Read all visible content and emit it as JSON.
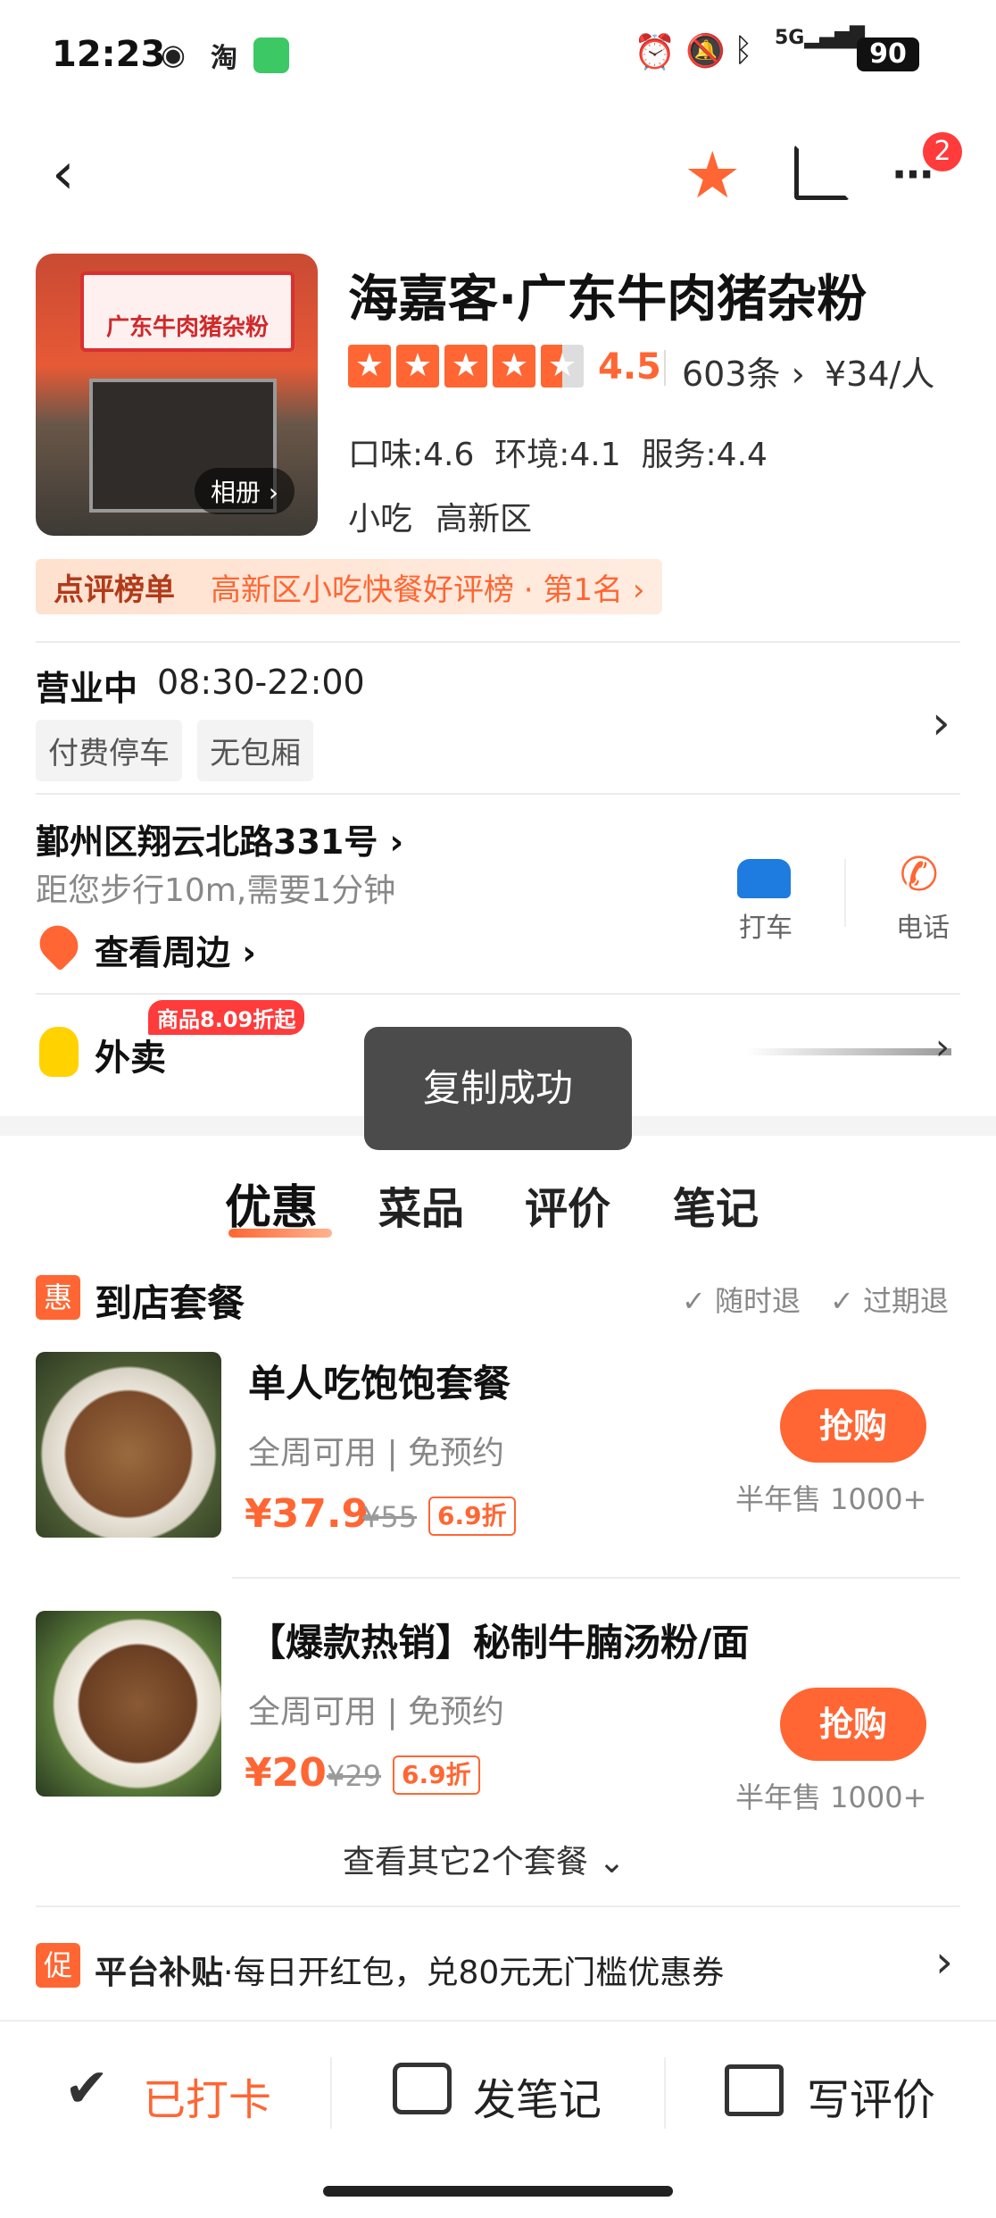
{
  "status": {
    "time": "12:23",
    "battery": "90"
  },
  "nav": {
    "badge_count": "2"
  },
  "shop": {
    "name": "海嘉客·广东牛肉猪杂粉",
    "sign": "广东牛肉猪杂粉",
    "album": "相册",
    "rating": "4.5",
    "stars": 4.5,
    "reviews": "603条",
    "price_per_person": "¥34/人",
    "scores": "口味:4.6  环境:4.1  服务:4.4",
    "category": "小吃",
    "district": "高新区"
  },
  "ranking": {
    "label": "点评榜单",
    "text": "高新区小吃快餐好评榜 · 第1名"
  },
  "hours": {
    "status": "营业中",
    "time": "08:30-22:00",
    "tags": [
      "付费停车",
      "无包厢"
    ]
  },
  "address": {
    "street": "鄞州区翔云北路331号",
    "distance": "距您步行10m,需要1分钟",
    "nearby": "查看周边",
    "taxi": "打车",
    "phone": "电话"
  },
  "delivery": {
    "label": "外卖",
    "promo": "商品8.09折起"
  },
  "toast": "复制成功",
  "tabs": [
    "优惠",
    "菜品",
    "评价",
    "笔记"
  ],
  "deals": {
    "badge": "惠",
    "title": "到店套餐",
    "refund1": "随时退",
    "refund2": "过期退",
    "items": [
      {
        "name": "单人吃饱饱套餐",
        "desc": "全周可用 | 免预约",
        "price": "¥37.9",
        "orig": "¥55",
        "discount": "6.9折",
        "buy": "抢购",
        "sold": "半年售 1000+"
      },
      {
        "name": "【爆款热销】秘制牛腩汤粉/面",
        "desc": "全周可用 | 免预约",
        "price": "¥20",
        "orig": "¥29",
        "discount": "6.9折",
        "buy": "抢购",
        "sold": "半年售 1000+"
      }
    ],
    "more": "查看其它2个套餐"
  },
  "subsidy": {
    "badge": "促",
    "title": "平台补贴",
    "text": "·每日开红包，兑80元无门槛优惠券"
  },
  "bottom": {
    "checkin": "已打卡",
    "note": "发笔记",
    "review": "写评价"
  },
  "colors": {
    "accent": "#ff6633",
    "star": "#ff6633"
  }
}
